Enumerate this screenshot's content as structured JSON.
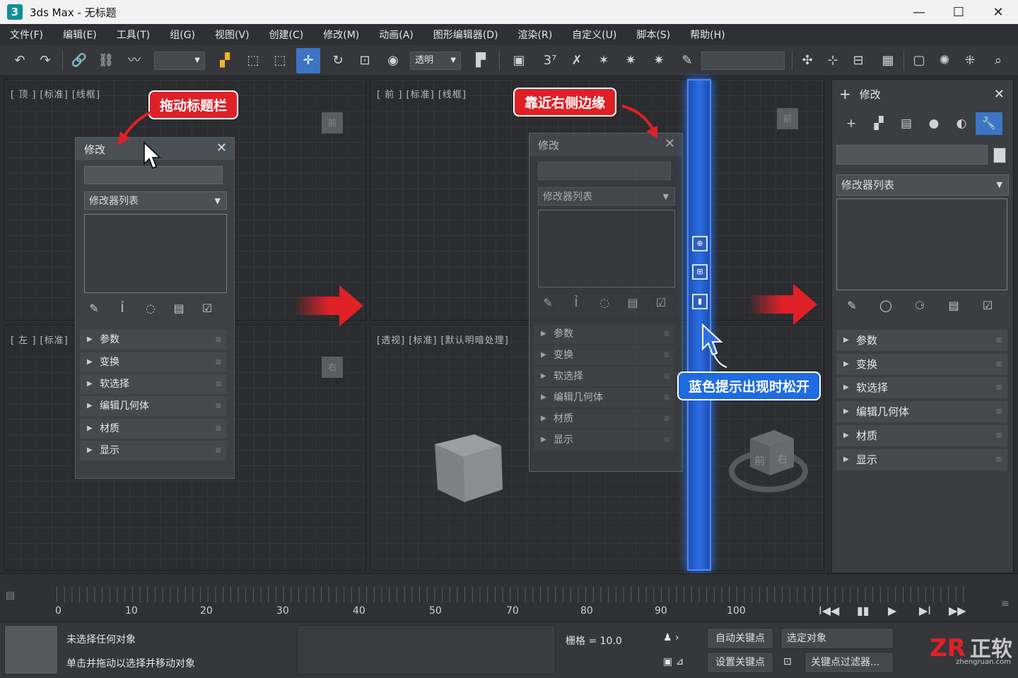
{
  "window": {
    "app_icon": "3",
    "title": "3ds Max - 无标题",
    "min": "—",
    "max": "☐",
    "close": "✕"
  },
  "menu": [
    "文件(F)",
    "编辑(E)",
    "工具(T)",
    "组(G)",
    "视图(V)",
    "创建(C)",
    "修改(M)",
    "动画(A)",
    "图形编辑器(D)",
    "渲染(R)",
    "自定义(U)",
    "脚本(S)",
    "帮助(H)"
  ],
  "toolbar": {
    "undo": "↶",
    "redo": "↷",
    "link": "🔗",
    "unlink": "⛓",
    "bind": "〰",
    "filter_value": "",
    "select": "▞",
    "select_region": "⬚",
    "window_crossing": "⬚",
    "move": "✛",
    "rotate": "↻",
    "scale": "⊡",
    "ref_coord_icon": "◉",
    "view_value": "透明",
    "pivot": "▛",
    "snaps_toggle": "▣",
    "snap_3d": "3⁷",
    "angle_snap": "✗",
    "percent_snap": "✶",
    "spinner_snap": "✷",
    "edit_named": "✎",
    "named_sel": "",
    "mirror": "✣",
    "align": "⊹",
    "layers": "⊟",
    "toggle_ribbon": "▦",
    "schematic": "▢",
    "material": "✺",
    "render_setup": "⁜",
    "zoom": "⌕"
  },
  "viewports": {
    "top": {
      "label": "[ 顶 ] [标准] [线框]",
      "cube": "前"
    },
    "front": {
      "label": "[ 前 ] [标准] [线框]",
      "cube": "前"
    },
    "left": {
      "label": "[ 左 ] [标准]",
      "cube": "右"
    },
    "perspective": {
      "label": "[透视] [标准] [默认明暗处理]",
      "cube_front": "前",
      "cube_right": "右"
    }
  },
  "floating_panel": {
    "title": "修改",
    "close": "✕",
    "modifier_list": "修改器列表",
    "icons": [
      "✎",
      "Ỉ",
      "◌",
      "▤",
      "☑"
    ],
    "rollouts": [
      "参数",
      "变换",
      "软选择",
      "编辑几何体",
      "材质",
      "显示"
    ]
  },
  "ghost_panel": {
    "title": "修改",
    "close": "✕",
    "modifier_list": "修改器列表",
    "icons": [
      "✎",
      "Ỉ",
      "◌",
      "▤",
      "☑"
    ],
    "rollouts": [
      "参数",
      "变换",
      "软选择",
      "编辑几何体",
      "材质",
      "显示"
    ]
  },
  "docked_panel": {
    "add": "+",
    "title": "修改",
    "close": "✕",
    "tabs": [
      "+",
      "▞",
      "▤",
      "●",
      "◐",
      "🔧"
    ],
    "modifier_list": "修改器列表",
    "icons": [
      "✎",
      "◯",
      "⚆",
      "▤",
      "☑"
    ],
    "rollouts": [
      "参数",
      "变换",
      "软选择",
      "编辑几何体",
      "材质",
      "显示"
    ]
  },
  "callouts": {
    "drag_title": "拖动标题栏",
    "near_right": "靠近右侧边缘",
    "release": "蓝色提示出现时松开"
  },
  "dock_icons": [
    "⊕",
    "⊞",
    "▮"
  ],
  "timeline": {
    "ticks": [
      "0",
      "10",
      "20",
      "30",
      "40",
      "50",
      "70",
      "80",
      "90",
      "100"
    ],
    "controls": [
      "I◀◀",
      "▮▮",
      "▶",
      "▶I",
      "▶▶"
    ]
  },
  "status": {
    "none_selected": "未选择任何对象",
    "hint": "单击并拖动以选择并移动对象",
    "grid": "栅格 = 10.0",
    "auto_key": "自动关键点",
    "set_key": "设置关键点",
    "selected_obj": "选定对象",
    "key_filter": "关键点过滤器..."
  },
  "logo": {
    "mark": "ZR",
    "text": "正软",
    "url": "zhengruan.com"
  }
}
